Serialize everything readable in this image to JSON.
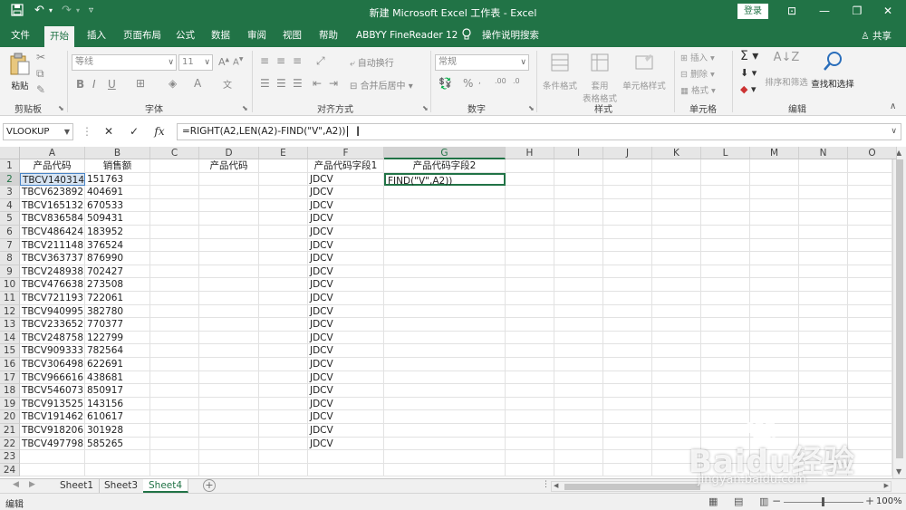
{
  "window": {
    "title": "新建 Microsoft Excel 工作表 - Excel",
    "login_label": "登录",
    "quick_access": [
      "save-icon",
      "undo-icon",
      "redo-icon",
      "customize-icon"
    ]
  },
  "tabs": [
    "文件",
    "开始",
    "插入",
    "页面布局",
    "公式",
    "数据",
    "审阅",
    "视图",
    "帮助",
    "ABBYY FineReader 12",
    "操作说明搜索"
  ],
  "active_tab": "开始",
  "share_label": "共享",
  "ribbon": {
    "clipboard": {
      "paste": "粘贴",
      "label": "剪贴板"
    },
    "font": {
      "name": "等线",
      "size": "11",
      "label": "字体",
      "bold": "B",
      "italic": "I",
      "underline": "U"
    },
    "alignment": {
      "wrap": "自动换行",
      "merge": "合并后居中",
      "label": "对齐方式"
    },
    "number": {
      "format": "常规",
      "label": "数字"
    },
    "styles": {
      "conditional": "条件格式",
      "table_line1": "套用",
      "table_line2": "表格格式",
      "cell_styles": "单元格样式",
      "label": "样式"
    },
    "cells": {
      "insert": "插入",
      "delete": "删除",
      "format": "格式",
      "label": "单元格"
    },
    "editing": {
      "sort": "排序和筛选",
      "find": "查找和选择",
      "label": "编辑"
    }
  },
  "formula_bar": {
    "name_box": "VLOOKUP",
    "formula_text": "=RIGHT(A2,LEN(A2)-FIND(\"V\",A2))"
  },
  "grid": {
    "columns": [
      "A",
      "B",
      "C",
      "D",
      "E",
      "F",
      "G",
      "H",
      "I",
      "J",
      "K",
      "L",
      "M",
      "N",
      "O"
    ],
    "row_numbers": [
      "1",
      "2",
      "3",
      "4",
      "5",
      "6",
      "7",
      "8",
      "9",
      "10",
      "11",
      "12",
      "13",
      "14",
      "15",
      "16",
      "17",
      "18",
      "19",
      "20",
      "21",
      "22",
      "23",
      "24"
    ],
    "headers": {
      "A": "产品代码",
      "B": "销售额",
      "D": "产品代码",
      "F": "产品代码字段1",
      "G": "产品代码字段2"
    },
    "col_a": [
      "TBCV140314",
      "TBCV623892",
      "TBCV165132",
      "TBCV836584",
      "TBCV486424",
      "TBCV211148",
      "TBCV363737",
      "TBCV248938",
      "TBCV476638",
      "TBCV721193",
      "TBCV940995",
      "TBCV233652",
      "TBCV248758",
      "TBCV909333",
      "TBCV306498",
      "TBCV966616",
      "TBCV546073",
      "TBCV913525",
      "TBCV191462",
      "TBCV918206",
      "TBCV497798"
    ],
    "col_b": [
      "151763",
      "404691",
      "670533",
      "509431",
      "183952",
      "376524",
      "876990",
      "702427",
      "273508",
      "722061",
      "382780",
      "770377",
      "122799",
      "782564",
      "622691",
      "438681",
      "850917",
      "143156",
      "610617",
      "301928",
      "585265"
    ],
    "col_f": [
      "JDCV",
      "JDCV",
      "JDCV",
      "JDCV",
      "JDCV",
      "JDCV",
      "JDCV",
      "JDCV",
      "JDCV",
      "JDCV",
      "JDCV",
      "JDCV",
      "JDCV",
      "JDCV",
      "JDCV",
      "JDCV",
      "JDCV",
      "JDCV",
      "JDCV",
      "JDCV",
      "JDCV"
    ],
    "g2_edit": "FIND(\"V\",A2))"
  },
  "sheets": [
    "Sheet1",
    "Sheet3",
    "Sheet4"
  ],
  "active_sheet": "Sheet4",
  "status": {
    "mode": "编辑",
    "zoom": "100%"
  },
  "watermark": {
    "text": "Baidu经验",
    "url": "jingyan.baidu.com"
  },
  "colors": {
    "excel_green": "#217346",
    "selection_blue": "#d7e4f2"
  }
}
